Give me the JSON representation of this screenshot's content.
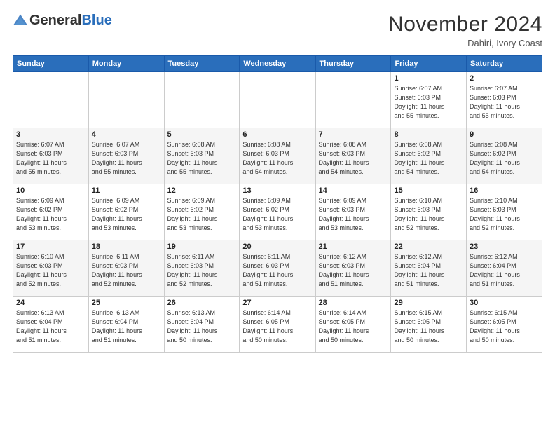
{
  "header": {
    "logo_general": "General",
    "logo_blue": "Blue",
    "month_title": "November 2024",
    "location": "Dahiri, Ivory Coast"
  },
  "weekdays": [
    "Sunday",
    "Monday",
    "Tuesday",
    "Wednesday",
    "Thursday",
    "Friday",
    "Saturday"
  ],
  "weeks": [
    [
      {
        "day": "",
        "info": ""
      },
      {
        "day": "",
        "info": ""
      },
      {
        "day": "",
        "info": ""
      },
      {
        "day": "",
        "info": ""
      },
      {
        "day": "",
        "info": ""
      },
      {
        "day": "1",
        "info": "Sunrise: 6:07 AM\nSunset: 6:03 PM\nDaylight: 11 hours\nand 55 minutes."
      },
      {
        "day": "2",
        "info": "Sunrise: 6:07 AM\nSunset: 6:03 PM\nDaylight: 11 hours\nand 55 minutes."
      }
    ],
    [
      {
        "day": "3",
        "info": "Sunrise: 6:07 AM\nSunset: 6:03 PM\nDaylight: 11 hours\nand 55 minutes."
      },
      {
        "day": "4",
        "info": "Sunrise: 6:07 AM\nSunset: 6:03 PM\nDaylight: 11 hours\nand 55 minutes."
      },
      {
        "day": "5",
        "info": "Sunrise: 6:08 AM\nSunset: 6:03 PM\nDaylight: 11 hours\nand 55 minutes."
      },
      {
        "day": "6",
        "info": "Sunrise: 6:08 AM\nSunset: 6:03 PM\nDaylight: 11 hours\nand 54 minutes."
      },
      {
        "day": "7",
        "info": "Sunrise: 6:08 AM\nSunset: 6:03 PM\nDaylight: 11 hours\nand 54 minutes."
      },
      {
        "day": "8",
        "info": "Sunrise: 6:08 AM\nSunset: 6:02 PM\nDaylight: 11 hours\nand 54 minutes."
      },
      {
        "day": "9",
        "info": "Sunrise: 6:08 AM\nSunset: 6:02 PM\nDaylight: 11 hours\nand 54 minutes."
      }
    ],
    [
      {
        "day": "10",
        "info": "Sunrise: 6:09 AM\nSunset: 6:02 PM\nDaylight: 11 hours\nand 53 minutes."
      },
      {
        "day": "11",
        "info": "Sunrise: 6:09 AM\nSunset: 6:02 PM\nDaylight: 11 hours\nand 53 minutes."
      },
      {
        "day": "12",
        "info": "Sunrise: 6:09 AM\nSunset: 6:02 PM\nDaylight: 11 hours\nand 53 minutes."
      },
      {
        "day": "13",
        "info": "Sunrise: 6:09 AM\nSunset: 6:02 PM\nDaylight: 11 hours\nand 53 minutes."
      },
      {
        "day": "14",
        "info": "Sunrise: 6:09 AM\nSunset: 6:03 PM\nDaylight: 11 hours\nand 53 minutes."
      },
      {
        "day": "15",
        "info": "Sunrise: 6:10 AM\nSunset: 6:03 PM\nDaylight: 11 hours\nand 52 minutes."
      },
      {
        "day": "16",
        "info": "Sunrise: 6:10 AM\nSunset: 6:03 PM\nDaylight: 11 hours\nand 52 minutes."
      }
    ],
    [
      {
        "day": "17",
        "info": "Sunrise: 6:10 AM\nSunset: 6:03 PM\nDaylight: 11 hours\nand 52 minutes."
      },
      {
        "day": "18",
        "info": "Sunrise: 6:11 AM\nSunset: 6:03 PM\nDaylight: 11 hours\nand 52 minutes."
      },
      {
        "day": "19",
        "info": "Sunrise: 6:11 AM\nSunset: 6:03 PM\nDaylight: 11 hours\nand 52 minutes."
      },
      {
        "day": "20",
        "info": "Sunrise: 6:11 AM\nSunset: 6:03 PM\nDaylight: 11 hours\nand 51 minutes."
      },
      {
        "day": "21",
        "info": "Sunrise: 6:12 AM\nSunset: 6:03 PM\nDaylight: 11 hours\nand 51 minutes."
      },
      {
        "day": "22",
        "info": "Sunrise: 6:12 AM\nSunset: 6:04 PM\nDaylight: 11 hours\nand 51 minutes."
      },
      {
        "day": "23",
        "info": "Sunrise: 6:12 AM\nSunset: 6:04 PM\nDaylight: 11 hours\nand 51 minutes."
      }
    ],
    [
      {
        "day": "24",
        "info": "Sunrise: 6:13 AM\nSunset: 6:04 PM\nDaylight: 11 hours\nand 51 minutes."
      },
      {
        "day": "25",
        "info": "Sunrise: 6:13 AM\nSunset: 6:04 PM\nDaylight: 11 hours\nand 51 minutes."
      },
      {
        "day": "26",
        "info": "Sunrise: 6:13 AM\nSunset: 6:04 PM\nDaylight: 11 hours\nand 50 minutes."
      },
      {
        "day": "27",
        "info": "Sunrise: 6:14 AM\nSunset: 6:05 PM\nDaylight: 11 hours\nand 50 minutes."
      },
      {
        "day": "28",
        "info": "Sunrise: 6:14 AM\nSunset: 6:05 PM\nDaylight: 11 hours\nand 50 minutes."
      },
      {
        "day": "29",
        "info": "Sunrise: 6:15 AM\nSunset: 6:05 PM\nDaylight: 11 hours\nand 50 minutes."
      },
      {
        "day": "30",
        "info": "Sunrise: 6:15 AM\nSunset: 6:05 PM\nDaylight: 11 hours\nand 50 minutes."
      }
    ]
  ]
}
